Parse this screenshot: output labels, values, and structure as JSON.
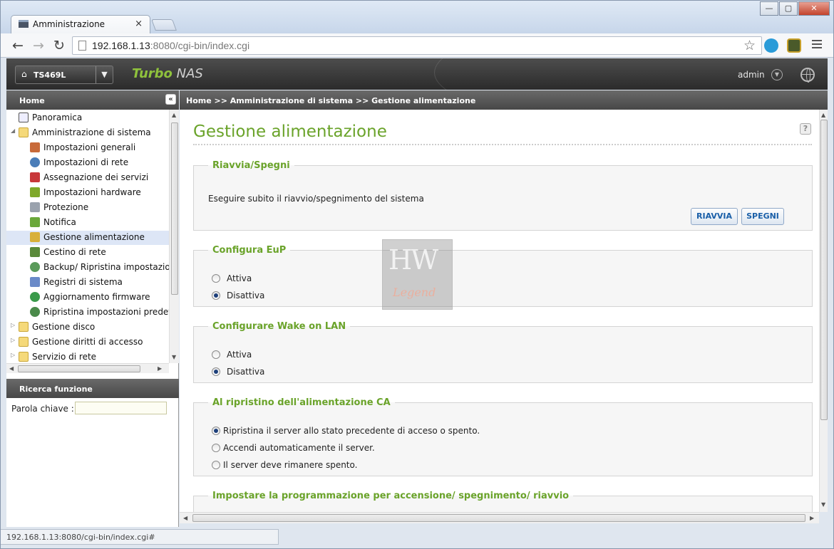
{
  "browser": {
    "tab_title": "Amministrazione",
    "tab_close": "×",
    "url_host": "192.168.1.13",
    "url_rest": ":8080/cgi-bin/index.cgi",
    "status_url": "192.168.1.13:8080/cgi-bin/index.cgi#",
    "icons": [
      "back-icon",
      "forward-icon",
      "reload-icon",
      "star-icon",
      "skype-extension-icon",
      "speed-extension-icon",
      "menu-icon"
    ]
  },
  "nas_header": {
    "device_name": "TS469L",
    "brand_turbo": "Turbo",
    "brand_nas": "NAS",
    "user": "admin"
  },
  "sidebar": {
    "title": "Home",
    "items": [
      {
        "label": "Panoramica",
        "icon": "overview-icon",
        "level": 1
      },
      {
        "label": "Amministrazione di sistema",
        "icon": "folder-open-icon",
        "level": 0
      },
      {
        "label": "Impostazioni generali",
        "icon": "general-settings-icon",
        "level": 2
      },
      {
        "label": "Impostazioni di rete",
        "icon": "network-icon",
        "level": 2
      },
      {
        "label": "Assegnazione dei servizi",
        "icon": "services-icon",
        "level": 2
      },
      {
        "label": "Impostazioni hardware",
        "icon": "hardware-icon",
        "level": 2
      },
      {
        "label": "Protezione",
        "icon": "security-icon",
        "level": 2
      },
      {
        "label": "Notifica",
        "icon": "notification-icon",
        "level": 2
      },
      {
        "label": "Gestione alimentazione",
        "icon": "power-icon",
        "level": 2,
        "selected": true
      },
      {
        "label": "Cestino di rete",
        "icon": "recycle-bin-icon",
        "level": 2
      },
      {
        "label": "Backup/ Ripristina impostazion",
        "icon": "backup-icon",
        "level": 2
      },
      {
        "label": "Registri di sistema",
        "icon": "logs-icon",
        "level": 2
      },
      {
        "label": "Aggiornamento firmware",
        "icon": "firmware-icon",
        "level": 2
      },
      {
        "label": "Ripristina impostazioni predefir",
        "icon": "restore-icon",
        "level": 2
      },
      {
        "label": "Gestione disco",
        "icon": "folder-icon",
        "level": 0
      },
      {
        "label": "Gestione diritti di accesso",
        "icon": "folder-icon",
        "level": 0
      },
      {
        "label": "Servizio di rete",
        "icon": "folder-icon",
        "level": 0
      }
    ],
    "search_title": "Ricerca funzione",
    "search_label": "Parola chiave :",
    "search_value": ""
  },
  "breadcrumb": "Home >> Amministrazione di sistema >> Gestione alimentazione",
  "page": {
    "title": "Gestione alimentazione",
    "sections": {
      "restart": {
        "legend": "Riavvia/Spegni",
        "description": "Eseguire subito il riavvio/spegnimento del sistema",
        "restart_button": "RIAVVIA",
        "shutdown_button": "SPEGNI"
      },
      "eup": {
        "legend": "Configura EuP",
        "options": [
          "Attiva",
          "Disattiva"
        ],
        "selected": "Disattiva"
      },
      "wol": {
        "legend": "Configurare Wake on LAN",
        "options": [
          "Attiva",
          "Disattiva"
        ],
        "selected": "Disattiva"
      },
      "ac_restore": {
        "legend": "Al ripristino dell'alimentazione CA",
        "options": [
          "Ripristina il server allo stato precedente di acceso o spento.",
          "Accendi automaticamente il server.",
          "Il server deve rimanere spento."
        ],
        "selected": "Ripristina il server allo stato precedente di acceso o spento."
      },
      "schedule": {
        "legend": "Impostare la programmazione per accensione/ spegnimento/ riavvio"
      }
    }
  }
}
